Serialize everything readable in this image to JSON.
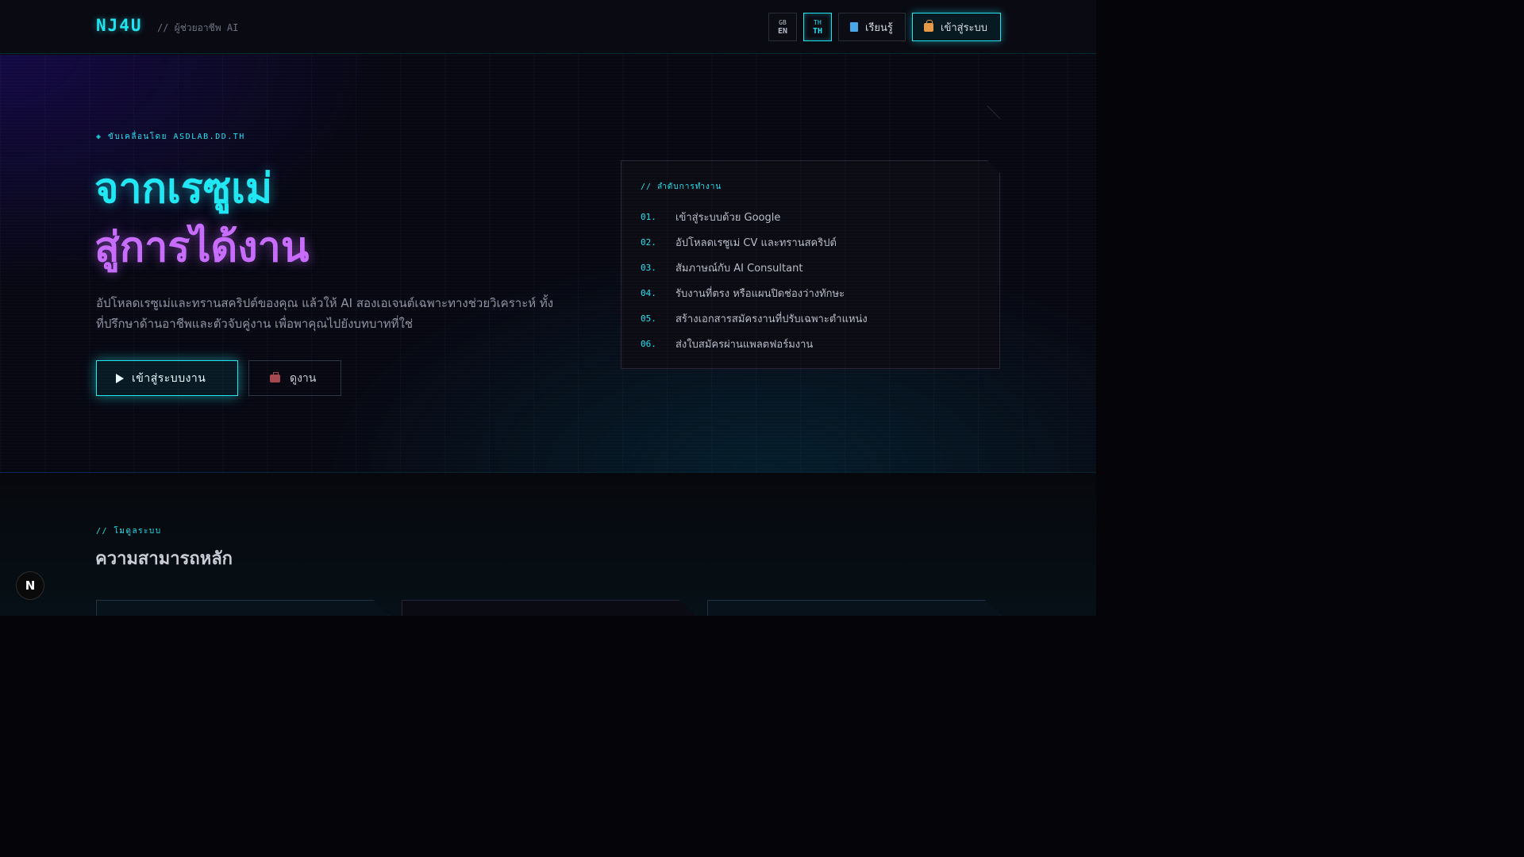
{
  "header": {
    "logo": "NJ4U",
    "tagline": "// ผู้ช่วยอาชีพ AI",
    "languages": [
      {
        "flag": "GB",
        "code": "EN",
        "active": false
      },
      {
        "flag": "TH",
        "code": "TH",
        "active": true
      }
    ],
    "learn_label": "เรียนรู้",
    "learn_icon": "book-icon",
    "login_label": "เข้าสู่ระบบ",
    "login_icon": "bag-icon"
  },
  "hero": {
    "kicker": "◈ ขับเคลื่อนโดย ASDLAB.DD.TH",
    "headline_line1": "จากเรซูเม่",
    "headline_line2": "สู่การได้งาน",
    "subtitle": "อัปโหลดเรซูเม่และทรานสคริปต์ของคุณ แล้วให้ AI สองเอเจนต์เฉพาะทางช่วยวิเคราะห์ ทั้งที่ปรึกษาด้านอาชีพและตัวจับคู่งาน เพื่อพาคุณไปยังบทบาทที่ใช่",
    "cta_primary": "เข้าสู่ระบบงาน",
    "cta_secondary": "ดูงาน",
    "colors": {
      "cyan": "#1fe8f4",
      "purple": "#c86cff"
    }
  },
  "workflow": {
    "title": "// ลำดับการทำงาน",
    "steps": [
      {
        "num": "01.",
        "text": "เข้าสู่ระบบด้วย Google"
      },
      {
        "num": "02.",
        "text": "อัปโหลดเรซูเม่ CV และทรานสคริปต์"
      },
      {
        "num": "03.",
        "text": "สัมภาษณ์กับ AI Consultant"
      },
      {
        "num": "04.",
        "text": "รับงานที่ตรง หรือแผนปิดช่องว่างทักษะ"
      },
      {
        "num": "05.",
        "text": "สร้างเอกสารสมัครงานที่ปรับเฉพาะตำแหน่ง"
      },
      {
        "num": "06.",
        "text": "ส่งใบสมัครผ่านแพลตฟอร์มงาน"
      }
    ]
  },
  "modules": {
    "kicker": "// โมดูลระบบ",
    "title": "ความสามารถหลัก"
  },
  "badge": {
    "letter": "N"
  }
}
